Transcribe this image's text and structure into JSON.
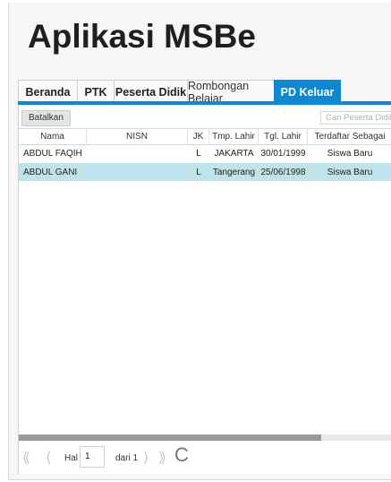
{
  "app": {
    "title": "Aplikasi MSBe"
  },
  "tabs": [
    {
      "label": "Beranda"
    },
    {
      "label": "PTK"
    },
    {
      "label": "Peserta Didik"
    },
    {
      "label": "Rombongan Belajar"
    },
    {
      "label": "PD Keluar",
      "active": true
    }
  ],
  "toolbar": {
    "batalkan_label": "Batalkan",
    "search_placeholder": "Cari Peserta Didik... (E"
  },
  "grid": {
    "columns": [
      "Nama",
      "NISN",
      "JK",
      "Tmp. Lahir",
      "Tgl. Lahir",
      "Terdaftar Sebagai"
    ],
    "rows": [
      {
        "nama": "ABDUL FAQIH",
        "nisn": "",
        "jk": "L",
        "tmp_lahir": "JAKARTA",
        "tgl_lahir": "30/01/1999",
        "terdaftar": "Siswa Baru",
        "selected": false
      },
      {
        "nama": "ABDUL GANI",
        "nisn": "",
        "jk": "L",
        "tmp_lahir": "Tangerang",
        "tgl_lahir": "25/06/1998",
        "terdaftar": "Siswa Baru",
        "selected": true
      }
    ]
  },
  "pager": {
    "first": "⟪",
    "prev": "⟨",
    "hal_label": "Hal",
    "page": "1",
    "of_label": "dari 1",
    "next": "⟩",
    "last": "⟫",
    "refresh": "C"
  },
  "colors": {
    "accent": "#0b88d6",
    "selected_row": "#bfe3ea"
  }
}
